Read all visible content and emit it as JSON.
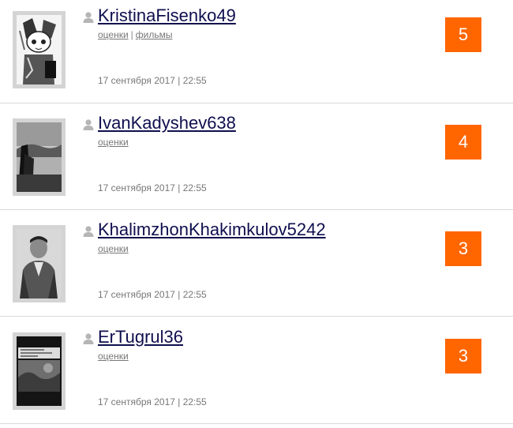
{
  "colors": {
    "score_bg": "#ff6600",
    "username": "#0f0f4f",
    "meta_text": "#777777",
    "divider": "#d9d9d9"
  },
  "entries": [
    {
      "username": "KristinaFisenko49",
      "links": [
        "оценки",
        "фильмы"
      ],
      "link_separator": "|",
      "date": "17 сентября 2017 | 22:55",
      "score": "5",
      "avatar_icon": "anime-character-avatar"
    },
    {
      "username": "IvanKadyshev638",
      "links": [
        "оценки"
      ],
      "link_separator": "|",
      "date": "17 сентября 2017 | 22:55",
      "score": "4",
      "avatar_icon": "landscape-photo-avatar"
    },
    {
      "username": "KhalimzhonKhakimkulov5242",
      "links": [
        "оценки"
      ],
      "link_separator": "|",
      "date": "17 сентября 2017 | 22:55",
      "score": "3",
      "avatar_icon": "portrait-photo-avatar"
    },
    {
      "username": "ErTugrul36",
      "links": [
        "оценки"
      ],
      "link_separator": "|",
      "date": "17 сентября 2017 | 22:55",
      "score": "3",
      "avatar_icon": "poster-avatar"
    }
  ]
}
